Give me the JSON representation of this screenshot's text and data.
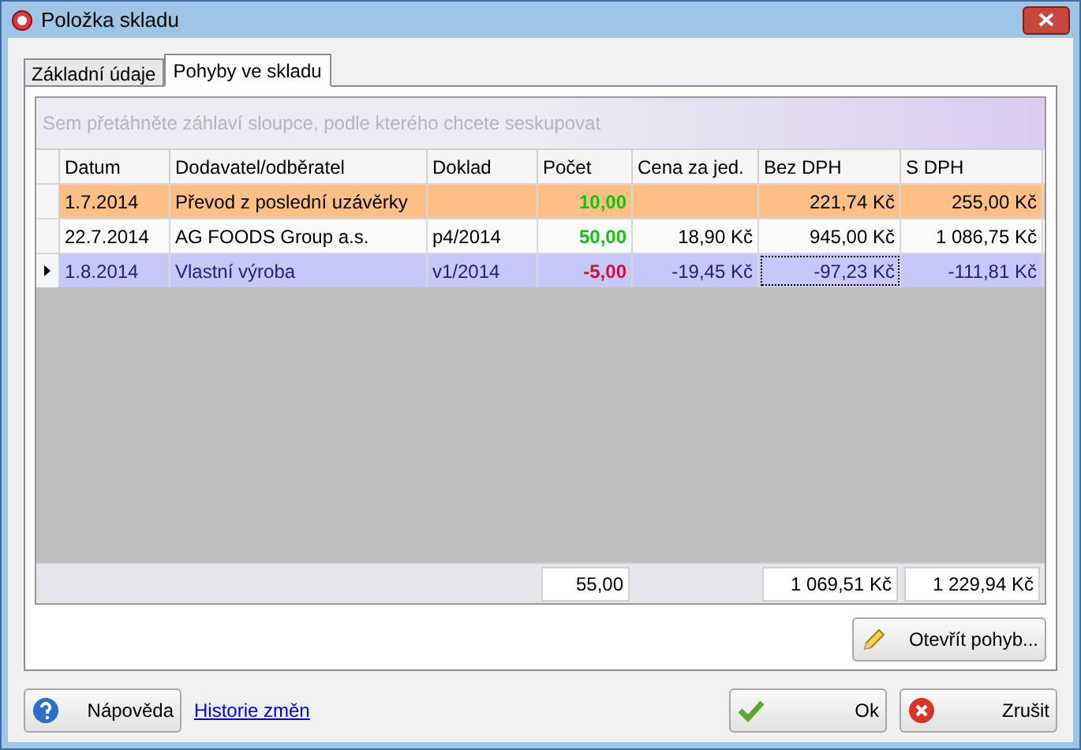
{
  "window": {
    "title": "Položka skladu"
  },
  "tabs": [
    {
      "label": "Základní údaje",
      "selected": false
    },
    {
      "label": "Pohyby ve skladu",
      "selected": true
    }
  ],
  "grid": {
    "group_hint": "Sem přetáhněte záhlaví sloupce, podle kterého chcete seskupovat",
    "columns": [
      "Datum",
      "Dodavatel/odběratel",
      "Doklad",
      "Počet",
      "Cena za jed.",
      "Bez DPH",
      "S DPH"
    ],
    "rows": [
      {
        "cells": [
          {
            "text": "1.7.2014",
            "focused": false
          },
          {
            "text": "Převod z poslední uzávěrky",
            "focused": false
          },
          {
            "focused": false
          },
          {
            "text": "10,00",
            "focused": false,
            "color": "#16c016"
          },
          {
            "focused": false
          },
          {
            "text": "221,74 Kč",
            "focused": false
          },
          {
            "text": "255,00 Kč",
            "focused": false
          }
        ],
        "color": "#fdbf86",
        "selected": false
      },
      {
        "cells": [
          {
            "text": "22.7.2014",
            "focused": false
          },
          {
            "text": "AG FOODS Group a.s.",
            "focused": false
          },
          {
            "text": "p4/2014",
            "focused": false
          },
          {
            "text": "50,00",
            "focused": false,
            "color": "#16c016"
          },
          {
            "text": "18,90 Kč",
            "focused": false
          },
          {
            "text": "945,00 Kč",
            "focused": false
          },
          {
            "text": "1 086,75 Kč",
            "focused": false
          }
        ],
        "color": "#f9f9f9",
        "selected": false
      },
      {
        "cells": [
          {
            "text": "1.8.2014",
            "focused": false
          },
          {
            "text": "Vlastní výroba",
            "focused": false
          },
          {
            "text": "v1/2014",
            "focused": false
          },
          {
            "text": "-5,00",
            "focused": false,
            "color": "#d0103a"
          },
          {
            "text": "-19,45 Kč",
            "focused": false
          },
          {
            "text": "-97,23 Kč",
            "focused": true
          },
          {
            "text": "-111,81 Kč",
            "focused": false
          }
        ],
        "color": "#c8c8f8",
        "selected": true
      }
    ],
    "totals": {
      "count": "55,00",
      "net": "1 069,51 Kč",
      "gross": "1 229,94 Kč"
    }
  },
  "open_button": "Otevřít pohyb...",
  "help_button": "Nápověda",
  "history_link": "Historie změn",
  "ok_button": "Ok",
  "cancel_button": "Zrušit"
}
